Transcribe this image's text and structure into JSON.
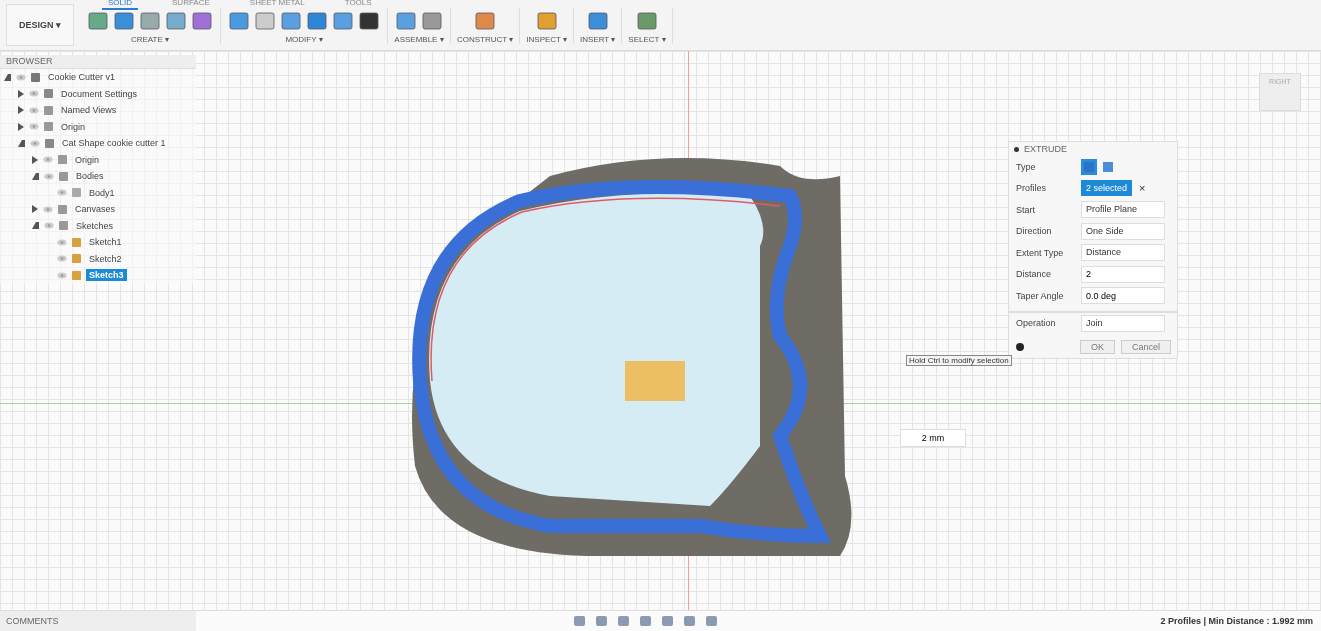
{
  "toolbar": {
    "workspace": "DESIGN ▾",
    "tabs": [
      {
        "label": "SOLID",
        "selected": true
      },
      {
        "label": "SURFACE",
        "selected": false
      },
      {
        "label": "SHEET METAL",
        "selected": false
      },
      {
        "label": "TOOLS",
        "selected": false
      }
    ],
    "groups": [
      {
        "label": "CREATE ▾",
        "tools": [
          {
            "kind": "sketch"
          },
          {
            "kind": "form"
          },
          {
            "kind": "box"
          },
          {
            "kind": "pattern"
          },
          {
            "kind": "insert"
          }
        ]
      },
      {
        "label": "MODIFY ▾",
        "tools": [
          {
            "kind": "press"
          },
          {
            "kind": "fillet"
          },
          {
            "kind": "shell"
          },
          {
            "kind": "combine"
          },
          {
            "kind": "layers"
          },
          {
            "kind": "move"
          }
        ]
      },
      {
        "label": "ASSEMBLE ▾",
        "tools": [
          {
            "kind": "component"
          },
          {
            "kind": "joint"
          }
        ]
      },
      {
        "label": "CONSTRUCT ▾",
        "tools": [
          {
            "kind": "plane"
          }
        ]
      },
      {
        "label": "INSPECT ▾",
        "tools": [
          {
            "kind": "measure"
          }
        ]
      },
      {
        "label": "INSERT ▾",
        "tools": [
          {
            "kind": "image"
          }
        ]
      },
      {
        "label": "SELECT ▾",
        "tools": [
          {
            "kind": "select"
          }
        ]
      }
    ]
  },
  "browser": {
    "title": "BROWSER",
    "tree": [
      {
        "label": "Cookie Cutter v1",
        "kind": "document",
        "expanded": true,
        "selected": false,
        "children": [
          {
            "label": "Document Settings",
            "kind": "gear",
            "expanded": false,
            "selected": false
          },
          {
            "label": "Named Views",
            "kind": "folder",
            "expanded": false,
            "selected": false
          },
          {
            "label": "Origin",
            "kind": "folder",
            "expanded": false,
            "selected": false
          },
          {
            "label": "Cat Shape cookie cutter 1",
            "kind": "component",
            "expanded": true,
            "selected": false,
            "children": [
              {
                "label": "Origin",
                "kind": "folder",
                "expanded": false,
                "selected": false
              },
              {
                "label": "Bodies",
                "kind": "folder",
                "expanded": true,
                "selected": false,
                "children": [
                  {
                    "label": "Body1",
                    "kind": "body",
                    "selected": false
                  }
                ]
              },
              {
                "label": "Canvases",
                "kind": "folder",
                "expanded": false,
                "selected": false
              },
              {
                "label": "Sketches",
                "kind": "folder",
                "expanded": true,
                "selected": false,
                "children": [
                  {
                    "label": "Sketch1",
                    "kind": "sketch",
                    "selected": false
                  },
                  {
                    "label": "Sketch2",
                    "kind": "sketch",
                    "selected": false
                  },
                  {
                    "label": "Sketch3",
                    "kind": "sketch",
                    "selected": true
                  }
                ]
              }
            ]
          }
        ]
      }
    ]
  },
  "viewcube": {
    "face": "RIGHT"
  },
  "extrude": {
    "title": "EXTRUDE",
    "rows": [
      {
        "label": "Type",
        "kind": "type"
      },
      {
        "label": "Profiles",
        "kind": "selection",
        "value": "2 selected",
        "clear": "×"
      },
      {
        "label": "Start",
        "kind": "dropdown",
        "value": "Profile Plane"
      },
      {
        "label": "Direction",
        "kind": "dropdown",
        "value": "One Side"
      },
      {
        "label": "Extent Type",
        "kind": "dropdown",
        "value": "Distance"
      },
      {
        "label": "Distance",
        "kind": "input",
        "value": "2"
      },
      {
        "label": "Taper Angle",
        "kind": "input",
        "value": "0.0 deg"
      },
      {
        "label": "Operation",
        "kind": "dropdown",
        "value": "Join"
      }
    ],
    "buttons": [
      "OK",
      "Cancel"
    ]
  },
  "tooltip": "Hold Ctrl to modify selection",
  "dimension": "2 mm",
  "comments": {
    "title": "COMMENTS"
  },
  "status": "2 Profiles | Min Distance : 1.992 mm"
}
